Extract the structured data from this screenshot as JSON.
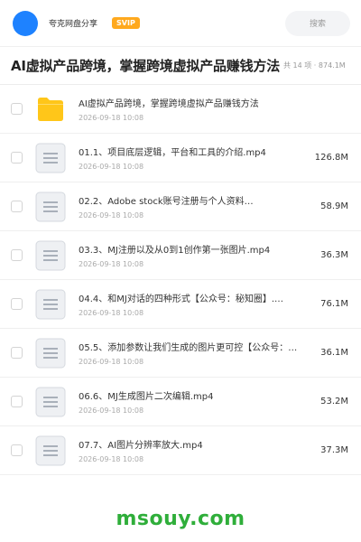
{
  "header": {
    "share_name": "夸克网盘分享",
    "badge": "SVIP",
    "search_placeholder": "搜索"
  },
  "folder": {
    "title": "AI虚拟产品跨境，掌握跨境虚拟产品赚钱方法",
    "meta": "共 14 项 · 874.1M"
  },
  "files": [
    {
      "type": "folder",
      "name": "AI虚拟产品跨境，掌握跨境虚拟产品赚钱方法",
      "date": "2026-09-18 10:08",
      "size": ""
    },
    {
      "type": "file",
      "name": "01.1、项目底层逻辑，平台和工具的介绍.mp4",
      "date": "2026-09-18 10:08",
      "size": "126.8M"
    },
    {
      "type": "file",
      "name": "02.2、Adobe stock账号注册与个人资料…",
      "date": "2026-09-18 10:08",
      "size": "58.9M"
    },
    {
      "type": "file",
      "name": "03.3、MJ注册以及从0到1创作第一张图片.mp4",
      "date": "2026-09-18 10:08",
      "size": "36.3M"
    },
    {
      "type": "file",
      "name": "04.4、和MJ对话的四种形式【公众号：秘知圈】.…",
      "date": "2026-09-18 10:08",
      "size": "76.1M"
    },
    {
      "type": "file",
      "name": "05.5、添加参数让我们生成的图片更可控【公众号：…",
      "date": "2026-09-18 10:08",
      "size": "36.1M"
    },
    {
      "type": "file",
      "name": "06.6、MJ生成图片二次编辑.mp4",
      "date": "2026-09-18 10:08",
      "size": "53.2M"
    },
    {
      "type": "file",
      "name": "07.7、AI图片分辨率放大.mp4",
      "date": "2026-09-18 10:08",
      "size": "37.3M"
    }
  ],
  "watermark": "msouy.com",
  "colors": {
    "avatar": "#1e82ff",
    "svip": "#ffa91e",
    "folder": "#ffc619",
    "watermark": "#2fae3a"
  }
}
